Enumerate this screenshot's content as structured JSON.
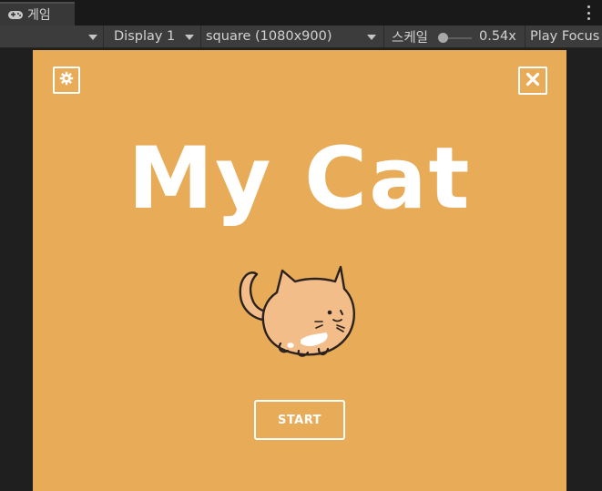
{
  "tab": {
    "label": "게임",
    "icon": "gamepad-icon"
  },
  "toolbar": {
    "display": "Display 1",
    "resolution": "square (1080x900)",
    "scale_label": "스케일",
    "scale_value": "0.54x",
    "play_focus": "Play Focus"
  },
  "game": {
    "background_color": "#e8ac58",
    "title": "My Cat",
    "start_label": "START",
    "settings_icon": "gear-icon",
    "close_icon": "close-icon",
    "cat_icon": "cat-illustration"
  }
}
